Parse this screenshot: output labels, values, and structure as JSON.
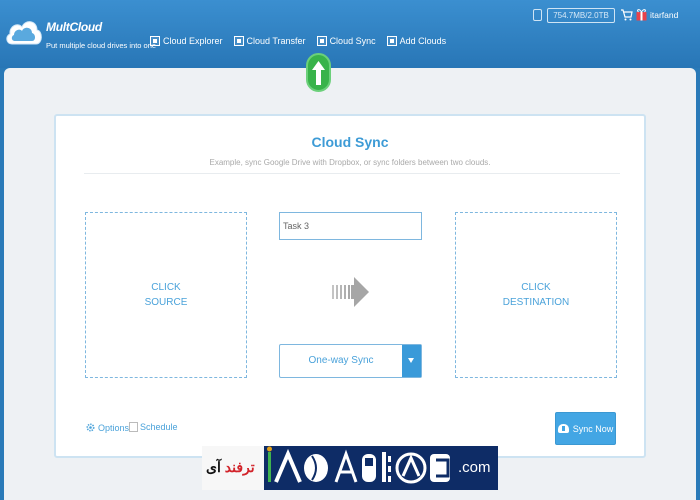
{
  "brand": {
    "name": "MultCloud",
    "tagline": "Put multiple cloud drives into one"
  },
  "nav": {
    "items": [
      {
        "label": "Cloud Explorer",
        "icon": "cloud-explorer-icon"
      },
      {
        "label": "Cloud Transfer",
        "icon": "cloud-transfer-icon"
      },
      {
        "label": "Cloud Sync",
        "icon": "cloud-sync-icon"
      },
      {
        "label": "Add Clouds",
        "icon": "add-clouds-icon"
      }
    ],
    "active_indicator": "green-up-arrow-icon"
  },
  "account": {
    "storage": "754.7MB/2.0TB",
    "username": "itarfand",
    "icons": [
      "storage-icon",
      "cart-icon",
      "gift-icon"
    ]
  },
  "cloud_sync": {
    "title": "Cloud Sync",
    "subtitle": "Example, sync Google Drive with Dropbox, or sync folders between two clouds.",
    "source_line1": "CLICK",
    "source_line2": "SOURCE",
    "destination_line1": "CLICK",
    "destination_line2": "DESTINATION",
    "task_name": "Task 3",
    "sync_mode": "One-way Sync",
    "options_label": "Options",
    "schedule_label": "Schedule",
    "sync_now_label": "Sync Now"
  },
  "watermark": {
    "fa_part1": "آی",
    "fa_part2": "ترفند",
    "domain": ".com"
  },
  "colors": {
    "header": "#2b7cbc",
    "accent": "#3d9bd6",
    "button": "#43a6e4",
    "indicator": "#38b34a"
  }
}
